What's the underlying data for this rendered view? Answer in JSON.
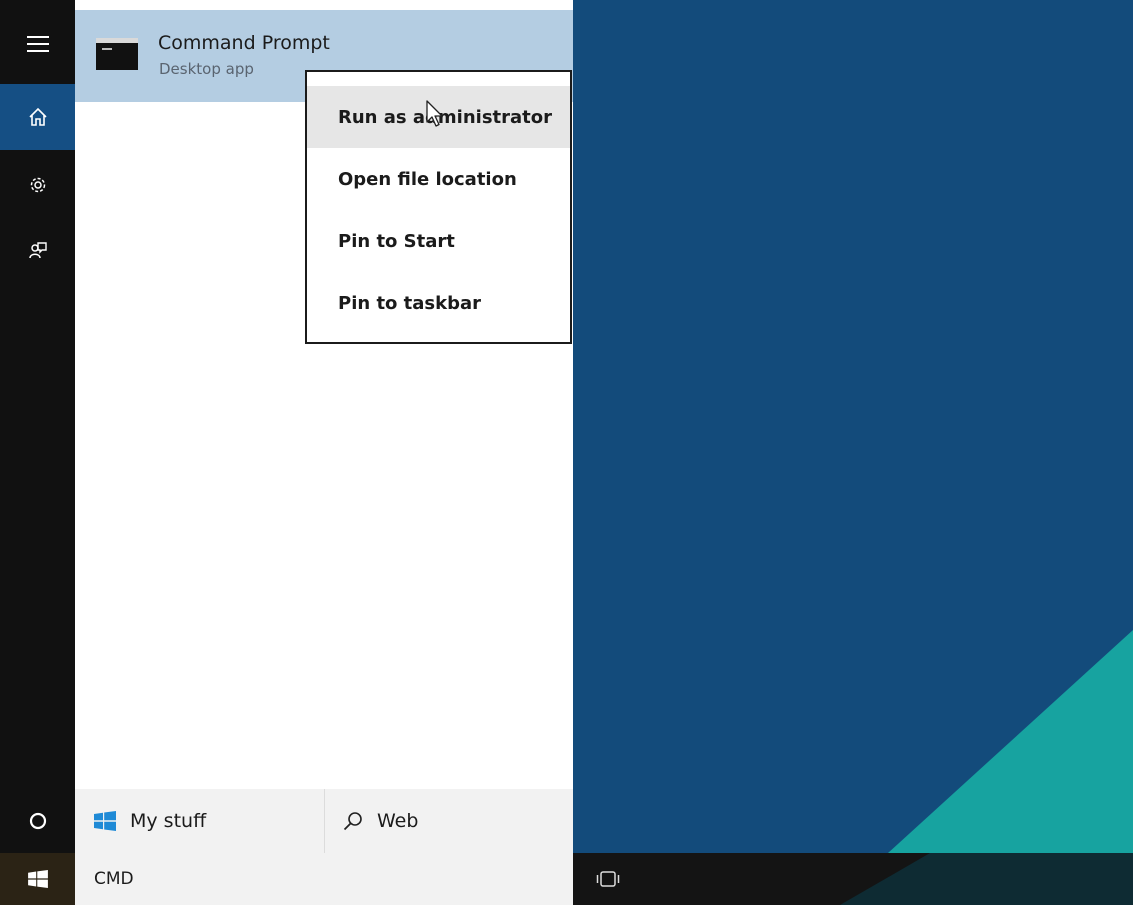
{
  "sidebar": {
    "items": [
      {
        "icon": "hamburger-icon"
      },
      {
        "icon": "home-icon",
        "active": true
      },
      {
        "icon": "gear-icon"
      },
      {
        "icon": "feedback-icon"
      }
    ],
    "cortana_icon": "circle-icon"
  },
  "result": {
    "title": "Command Prompt",
    "subtitle": "Desktop app",
    "icon": "command-prompt-icon"
  },
  "context_menu": {
    "items": [
      {
        "label": "Run as administrator",
        "hovered": true
      },
      {
        "label": "Open file location"
      },
      {
        "label": "Pin to Start"
      },
      {
        "label": "Pin to taskbar"
      }
    ]
  },
  "filters": {
    "my_stuff": "My stuff",
    "web": "Web"
  },
  "taskbar": {
    "search_value": "CMD"
  },
  "colors": {
    "accent": "#154f84",
    "selected_result": "#b4cde2",
    "desktop_blue": "#134b7b",
    "desktop_teal": "#17a3a0",
    "windows_logo": "#1f8ad6"
  }
}
